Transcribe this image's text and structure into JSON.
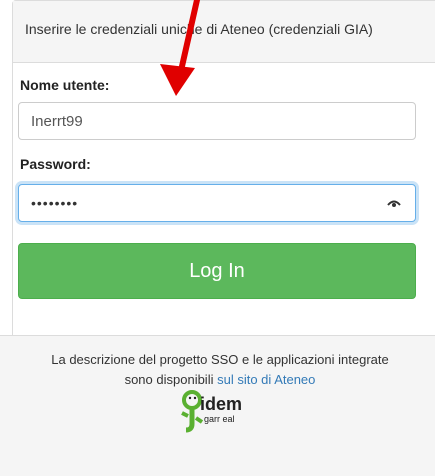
{
  "panel": {
    "heading": "Inserire le credenziali uniche di Ateneo (credenziali GIA)"
  },
  "form": {
    "username_label": "Nome utente:",
    "username_value": "Inerrt99",
    "password_label": "Password:",
    "password_masked": "••••••••",
    "login_label": "Log In"
  },
  "footer": {
    "text_line1": "La descrizione del progetto SSO e le applicazioni integrate",
    "text_line2_prefix": "sono disponibili",
    "link_text": "sul sito di Ateneo",
    "logo_text_main": "idem",
    "logo_text_sub": "garr eal"
  },
  "colors": {
    "login_button": "#5cb85c",
    "arrow": "#e00000",
    "link": "#337ab7",
    "logo_green": "#5ab031"
  },
  "icons": {
    "password_toggle": "eye-icon",
    "annotation": "red-arrow"
  }
}
